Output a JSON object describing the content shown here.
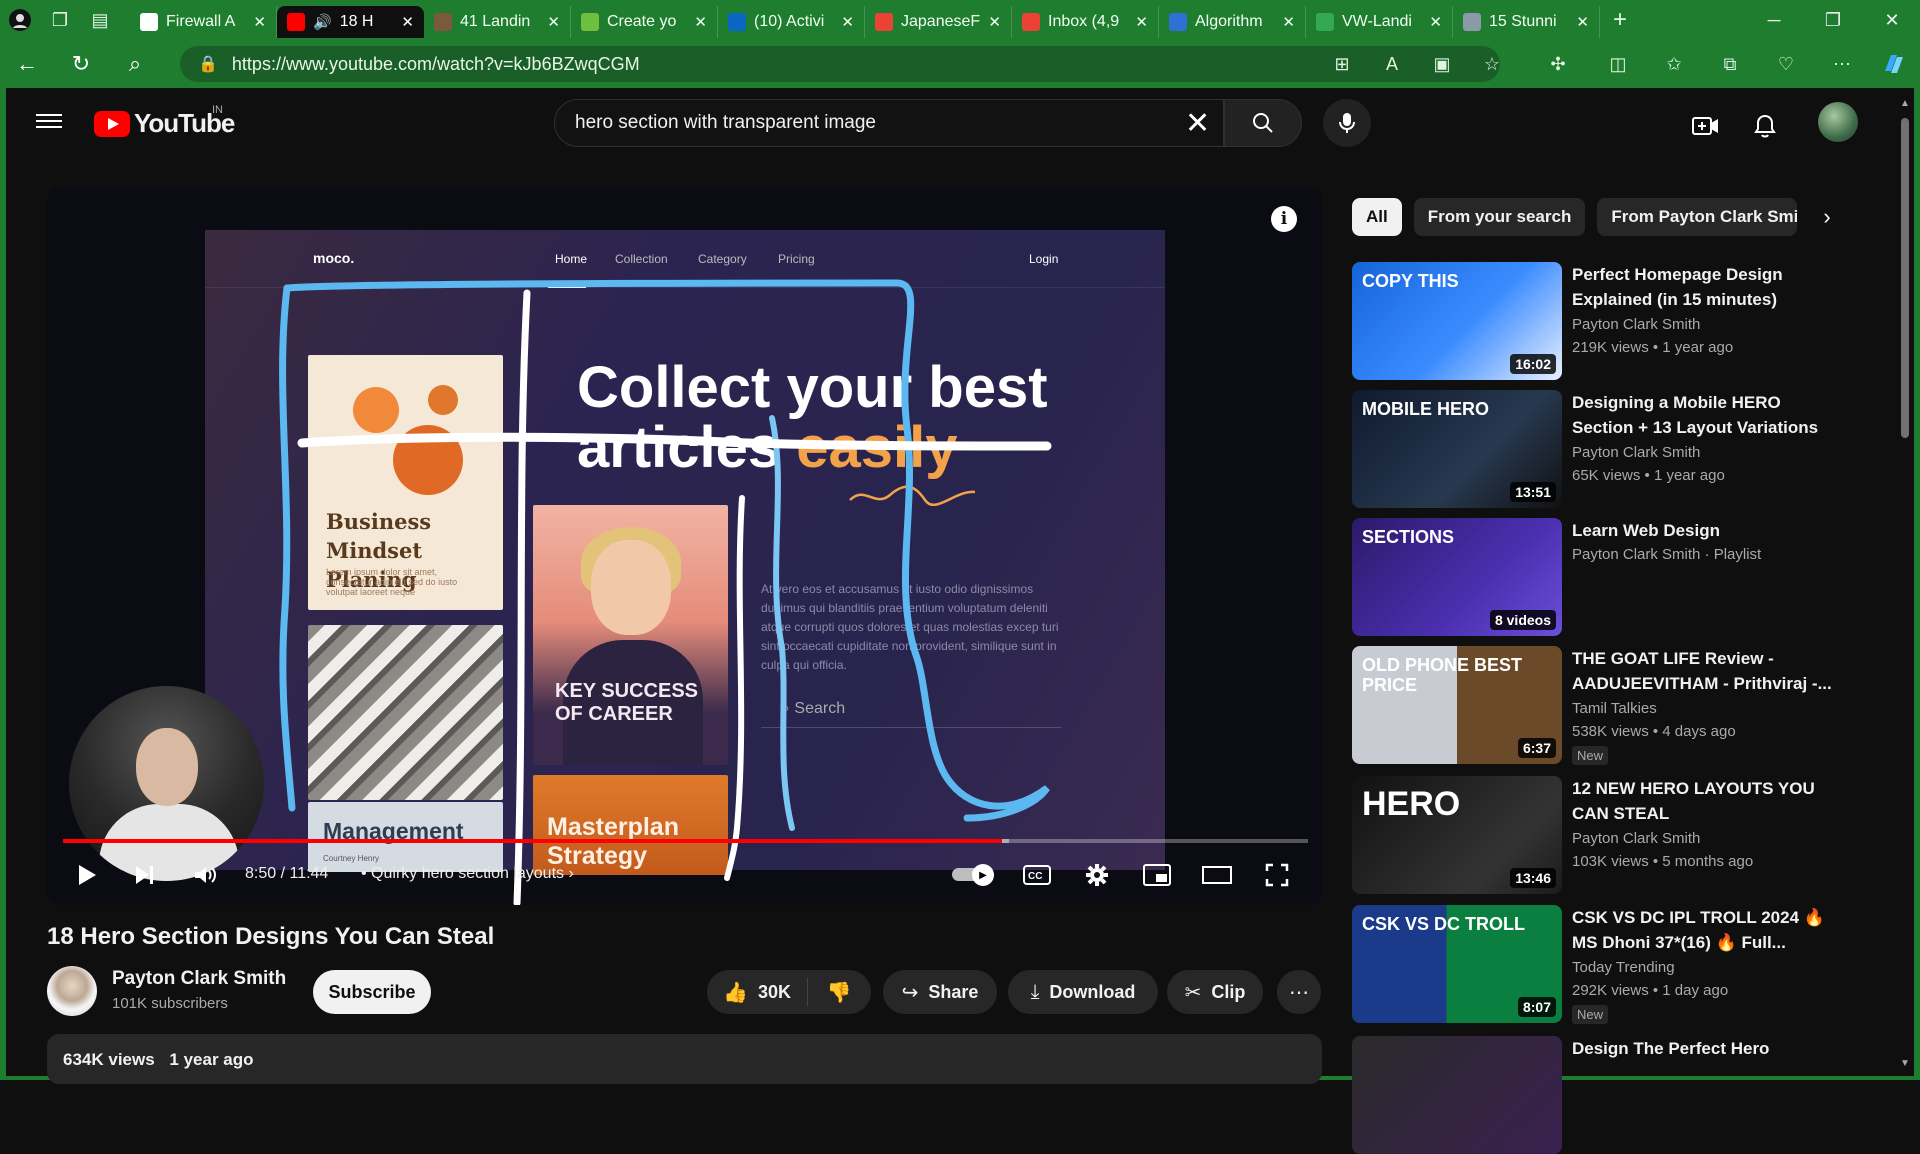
{
  "browser": {
    "tabs": [
      {
        "title": "Firewall A",
        "fav": "#ffffff"
      },
      {
        "title": "18 H",
        "fav": "#ff0000",
        "active": true
      },
      {
        "title": "41 Landin",
        "fav": "#7a5a3a"
      },
      {
        "title": "Create yo",
        "fav": "#6fbf3f"
      },
      {
        "title": "(10) Activi",
        "fav": "#0a66c2"
      },
      {
        "title": "JapaneseF",
        "fav": "#ea4335"
      },
      {
        "title": "Inbox (4,9",
        "fav": "#ea4335"
      },
      {
        "title": "Algorithm",
        "fav": "#2f6fd6"
      },
      {
        "title": "VW-Landi",
        "fav": "#34a853"
      },
      {
        "title": "15 Stunni",
        "fav": "#8a9aa8"
      }
    ],
    "url": "https://www.youtube.com/watch?v=kJb6BZwqCGM"
  },
  "header": {
    "logo_text": "YouTube",
    "country": "IN",
    "search_query": "hero section with transparent image"
  },
  "player": {
    "frame": {
      "brand": "moco.",
      "nav": [
        "Home",
        "Collection",
        "Category",
        "Pricing"
      ],
      "login": "Login",
      "headline_1": "Collect your best",
      "headline_2a": "articles ",
      "headline_2b": "easily",
      "paragraph": "At vero eos et accusamus et iusto odio dignissimos ducimus qui blanditiis praesentium voluptatum deleniti atque corrupti quos dolores et quas molestias excep turi sint occaecati cupiditate non provident, similique sunt in culpa qui officia.",
      "search": "Search",
      "card1_title": "Business Mindset Planing",
      "card1_sub": "Lorem ipsum dolor sit amet, consectetur adip elit sed do iusto volutpat laoreet neque",
      "card3_title": "Management",
      "card3_sub": "Courtney Henry",
      "card4_title": "KEY SUCCESS OF CAREER",
      "card5_title": "Masterplan Strategy"
    },
    "time_current": "8:50",
    "time_total": "11:44",
    "time_display": "8:50 / 11:44",
    "chapter": "Quirky hero section layouts",
    "progress": 0.754,
    "buffered": 0.76
  },
  "video": {
    "title": "18 Hero Section Designs You Can Steal",
    "channel": "Payton Clark Smith",
    "subscribers": "101K subscribers",
    "subscribe_label": "Subscribe",
    "likes": "30K",
    "share_label": "Share",
    "download_label": "Download",
    "clip_label": "Clip",
    "views": "634K views",
    "age": "1 year ago"
  },
  "chips": [
    "All",
    "From your search",
    "From Payton Clark Smith"
  ],
  "recommendations": [
    {
      "title": "Perfect Homepage Design Explained (in 15 minutes)",
      "channel": "Payton Clark Smith",
      "meta": "219K views • 1 year ago",
      "duration": "16:02",
      "thumb_text": "COPY THIS"
    },
    {
      "title": "Designing a Mobile HERO Section + 13 Layout Variations",
      "channel": "Payton Clark Smith",
      "meta": "65K views • 1 year ago",
      "duration": "13:51",
      "thumb_text": "MOBILE HERO"
    },
    {
      "title": "Learn Web Design",
      "channel": "Payton Clark Smith · Playlist",
      "meta": "",
      "duration": "8 videos",
      "thumb_text": "SECTIONS"
    },
    {
      "title": "THE GOAT LIFE Review - AADUJEEVITHAM - Prithviraj -...",
      "channel": "Tamil Talkies",
      "meta": "538K views • 4 days ago",
      "duration": "6:37",
      "badge": "New",
      "thumb_text": "OLD PHONE BEST PRICE"
    },
    {
      "title": "12 NEW HERO LAYOUTS YOU CAN STEAL",
      "channel": "Payton Clark Smith",
      "meta": "103K views • 5 months ago",
      "duration": "13:46",
      "thumb_text": "HERO"
    },
    {
      "title": "CSK VS DC IPL TROLL 2024 🔥 MS Dhoni 37*(16) 🔥 Full...",
      "channel": "Today Trending",
      "meta": "292K views • 1 day ago",
      "duration": "8:07",
      "badge": "New",
      "thumb_text": "CSK VS DC TROLL"
    },
    {
      "title": "Design The Perfect Hero",
      "channel": "",
      "meta": "",
      "duration": ""
    }
  ],
  "colors": {
    "brand_red": "#ff0000",
    "browser_green": "#1e7d2f",
    "accent_orange": "#f4a24a",
    "scribble_blue": "#5bb8f0"
  }
}
